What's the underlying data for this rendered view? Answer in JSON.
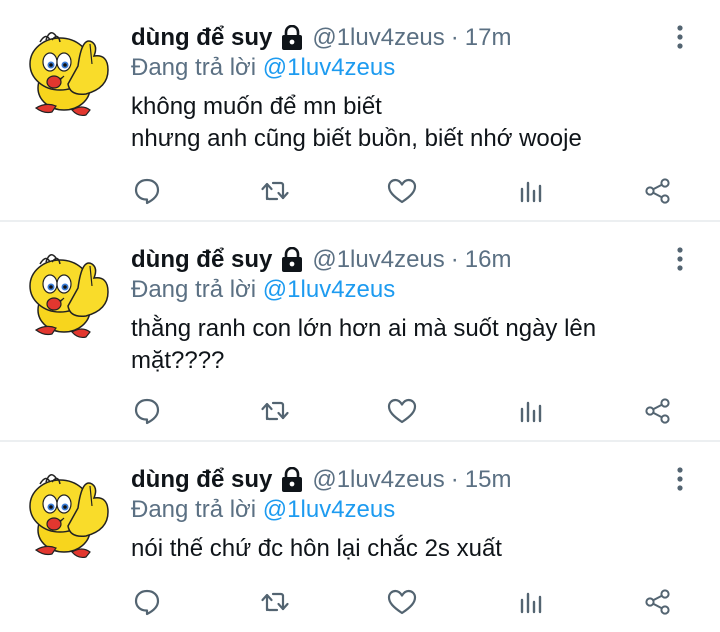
{
  "tweets": [
    {
      "display_name": "dùng để suy",
      "handle": "@1luv4zeus",
      "separator": "·",
      "time": "17m",
      "reply_prefix": "Đang trả lời",
      "reply_to": "@1luv4zeus",
      "text": "không muốn để mn biết\nnhưng anh cũng biết buồn, biết nhớ wooje"
    },
    {
      "display_name": "dùng để suy",
      "handle": "@1luv4zeus",
      "separator": "·",
      "time": "16m",
      "reply_prefix": "Đang trả lời",
      "reply_to": "@1luv4zeus",
      "text": "thằng ranh con lớn hơn ai mà suốt ngày lên\nmặt????"
    },
    {
      "display_name": "dùng để suy",
      "handle": "@1luv4zeus",
      "separator": "·",
      "time": "15m",
      "reply_prefix": "Đang trả lời",
      "reply_to": "@1luv4zeus",
      "text": "nói thế chứ đc hôn lại chắc 2s xuất"
    }
  ],
  "icons": {
    "avatar": "yellow-cartoon-bird-avatar",
    "lock": "lock-icon",
    "more": "vertical-ellipsis-icon",
    "reply": "speech-bubble-icon",
    "retweet": "retweet-icon",
    "like": "heart-icon",
    "stats": "bar-chart-icon",
    "share": "share-icon"
  },
  "colors": {
    "text": "#0f1419",
    "muted": "#5b7083",
    "link": "#1d9bf0",
    "icon": "#536471",
    "divider": "#eceff1"
  }
}
